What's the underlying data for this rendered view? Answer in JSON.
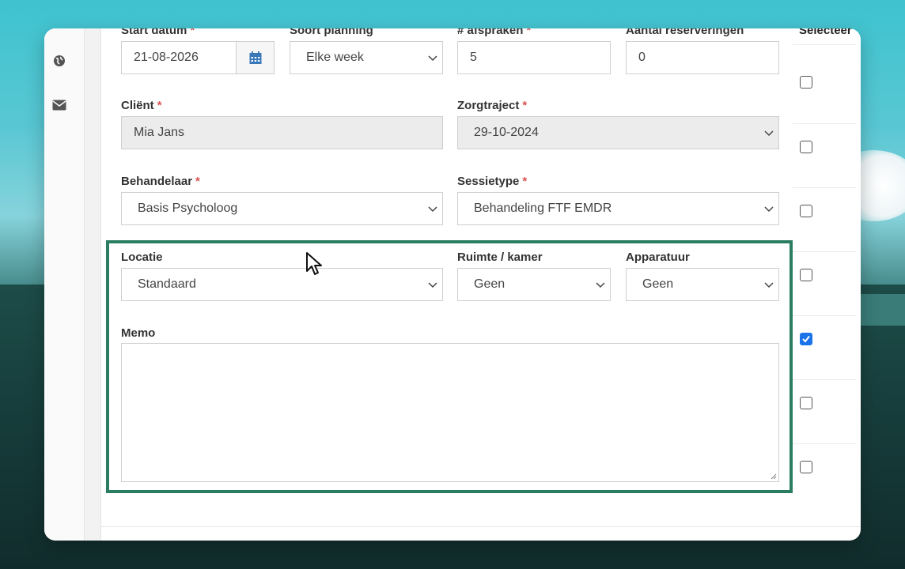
{
  "form": {
    "start_datum": {
      "label": "Start datum",
      "required_mark": "*",
      "value": "21-08-2026"
    },
    "soort_planning": {
      "label": "Soort planning",
      "value": "Elke week"
    },
    "afspraken": {
      "label": "# afspraken",
      "required_mark": "*",
      "value": "5"
    },
    "reserveringen": {
      "label": "Aantal reserveringen",
      "value": "0"
    },
    "client": {
      "label": "Cliënt",
      "required_mark": "*",
      "value": "Mia Jans"
    },
    "zorgtraject": {
      "label": "Zorgtraject",
      "required_mark": "*",
      "value": "29-10-2024"
    },
    "behandelaar": {
      "label": "Behandelaar",
      "required_mark": "*",
      "value": "Basis Psycholoog"
    },
    "sessietype": {
      "label": "Sessietype",
      "required_mark": "*",
      "value": "Behandeling FTF EMDR"
    },
    "locatie": {
      "label": "Locatie",
      "value": "Standaard"
    },
    "ruimte": {
      "label": "Ruimte / kamer",
      "value": "Geen"
    },
    "apparatuur": {
      "label": "Apparatuur",
      "value": "Geen"
    },
    "memo": {
      "label": "Memo",
      "value": ""
    }
  },
  "select_column": {
    "header": "Selecteer",
    "checkboxes": [
      false,
      false,
      false,
      false,
      true,
      false,
      false
    ]
  },
  "icons": [
    "globe-icon",
    "envelope-icon",
    "calendar-icon",
    "chevron-down-icon",
    "resize-grip-icon",
    "mouse-cursor-icon",
    "checkmark-icon"
  ],
  "colors": {
    "highlight_border": "#2b7d62",
    "required": "#d9534f",
    "checkbox_checked": "#1a73e8",
    "calendar_icon": "#3a78b8"
  }
}
